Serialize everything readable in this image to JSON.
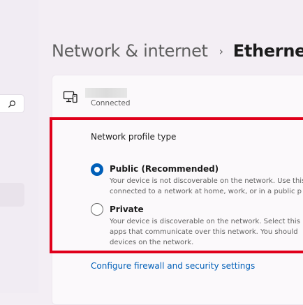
{
  "breadcrumb": {
    "parent": "Network & internet",
    "separator": "›",
    "current": "Ethernet"
  },
  "connection": {
    "icon": "pc-icon",
    "status": "Connected"
  },
  "network_profile": {
    "title": "Network profile type",
    "options": [
      {
        "label": "Public (Recommended)",
        "selected": true,
        "desc": [
          "Your device is not discoverable on the network. Use this",
          "connected to a network at home, work, or in a public p"
        ]
      },
      {
        "label": "Private",
        "selected": false,
        "desc": [
          "Your device is discoverable on the network. Select this",
          "apps that communicate over this network. You should",
          "devices on the network."
        ]
      }
    ]
  },
  "links": {
    "firewall": "Configure firewall and security settings"
  },
  "colors": {
    "accent": "#005fb8",
    "highlight_border": "#e0001a",
    "background": "#f3eef4",
    "card": "#fbf9fb"
  }
}
